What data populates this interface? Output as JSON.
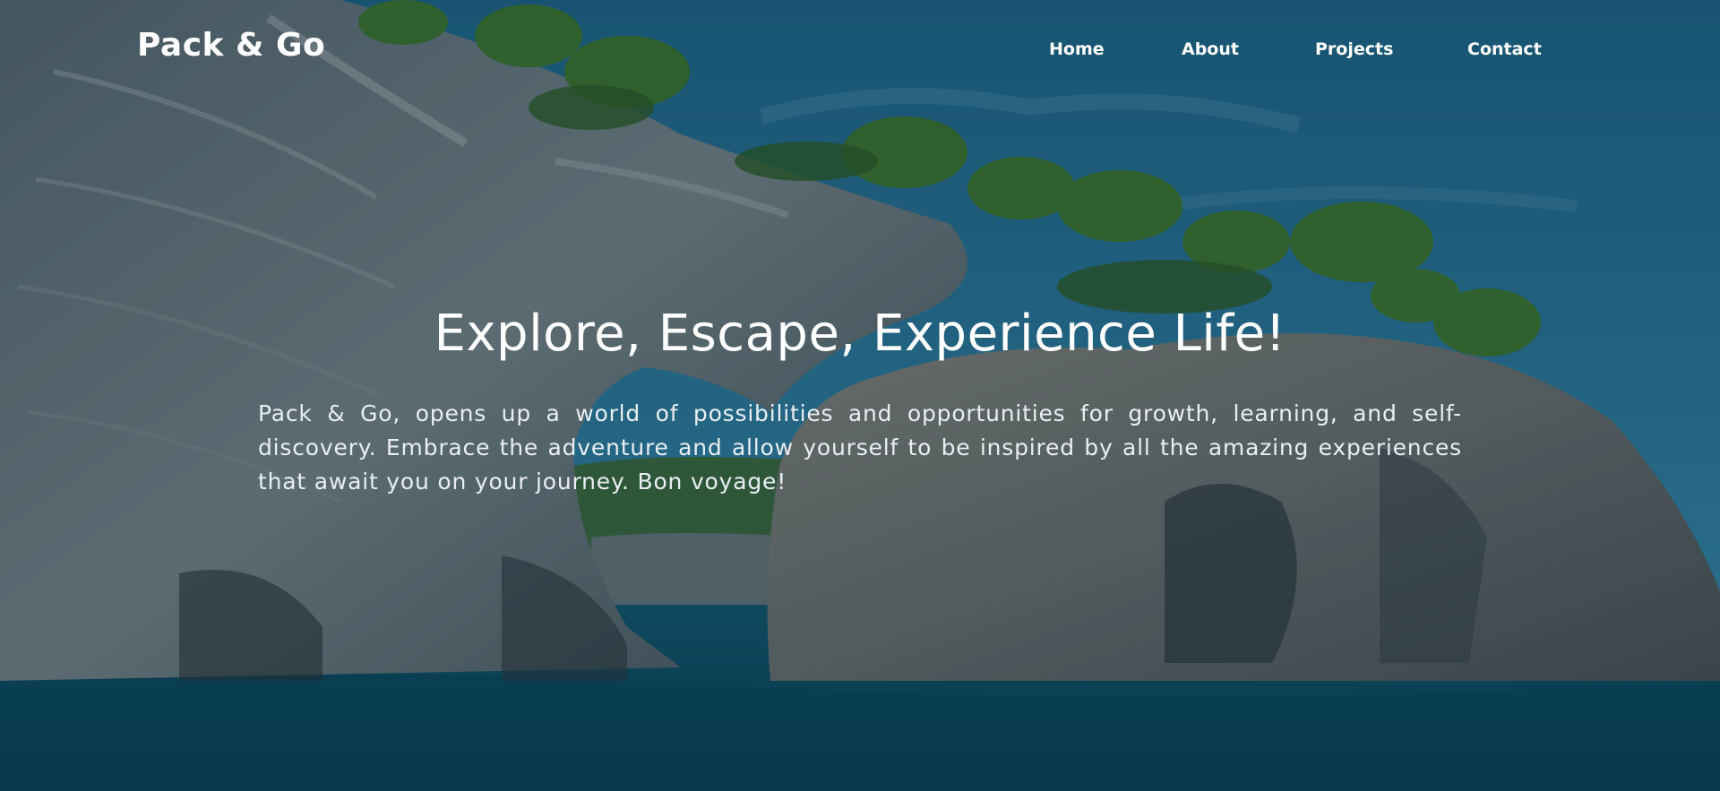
{
  "brand": {
    "name": "Pack & Go"
  },
  "nav": {
    "items": [
      {
        "label": "Home"
      },
      {
        "label": "About"
      },
      {
        "label": "Projects"
      },
      {
        "label": "Contact"
      }
    ]
  },
  "hero": {
    "headline": "Explore, Escape, Experience Life!",
    "tagline": "Pack & Go, opens up a world of possibilities and opportunities for growth, learning, and self-discovery. Embrace the adventure and allow yourself to be inspired by all the amazing experiences that await you on your journey. Bon voyage!"
  },
  "colors": {
    "text": "#ffffff",
    "overlay": "#0b2232",
    "sea": "#0f5a6f",
    "sky": "#2f7fa0"
  }
}
